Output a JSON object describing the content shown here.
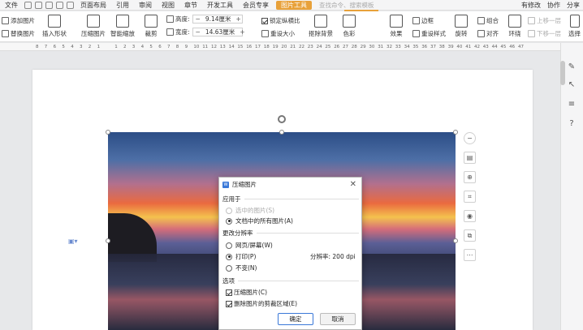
{
  "menu": {
    "file": "文件",
    "tabs": [
      "页面布局",
      "引用",
      "审阅",
      "视图",
      "章节",
      "开发工具",
      "会员专享"
    ],
    "active_tab": "图片工具",
    "search_placeholder": "查找命令、搜索模板",
    "changed": "有修改",
    "collab": "协作",
    "share": "分享"
  },
  "ribbon": {
    "add_picture": "添加图片",
    "replace_picture": "替换图片",
    "insert_shape": "插入形状",
    "compress_picture": "压缩图片",
    "smart_zoom": "智能缩放",
    "crop": "裁剪",
    "height_label": "高度:",
    "height_value": "9.14厘米",
    "width_label": "宽度:",
    "width_value": "14.63厘米",
    "lock_ratio": "锁定纵横比",
    "reset_size": "重设大小",
    "remove_background": "抠除背景",
    "color": "色彩",
    "effects": "效果",
    "border": "边框",
    "reset_style": "重设样式",
    "rotate": "旋转",
    "group": "组合",
    "align": "对齐",
    "wrap": "环绕",
    "bring_forward": "上移一层",
    "send_backward": "下移一层",
    "select": "选择"
  },
  "ruler": [
    "8",
    "7",
    "6",
    "5",
    "4",
    "3",
    "2",
    "1",
    "",
    "1",
    "2",
    "3",
    "4",
    "5",
    "6",
    "7",
    "8",
    "9",
    "10",
    "11",
    "12",
    "13",
    "14",
    "15",
    "16",
    "17",
    "18",
    "19",
    "20",
    "21",
    "22",
    "23",
    "24",
    "25",
    "26",
    "27",
    "28",
    "29",
    "30",
    "31",
    "32",
    "33",
    "34",
    "35",
    "36",
    "37",
    "38",
    "39",
    "40",
    "41",
    "42",
    "43",
    "44",
    "45",
    "46",
    "47"
  ],
  "dialog": {
    "title": "压缩图片",
    "apply_to": "应用于",
    "selected_pictures": "选中的图片(S)",
    "all_pictures": "文档中的所有图片(A)",
    "change_resolution": "更改分辨率",
    "web_screen": "网页/屏幕(W)",
    "print": "打印(P)",
    "resolution": "分辨率:  200 dpi",
    "no_change": "不变(N)",
    "options": "选项",
    "compress_option": "压缩图片(C)",
    "delete_cropped": "删除图片的剪裁区域(E)",
    "ok": "确定",
    "cancel": "取消"
  }
}
